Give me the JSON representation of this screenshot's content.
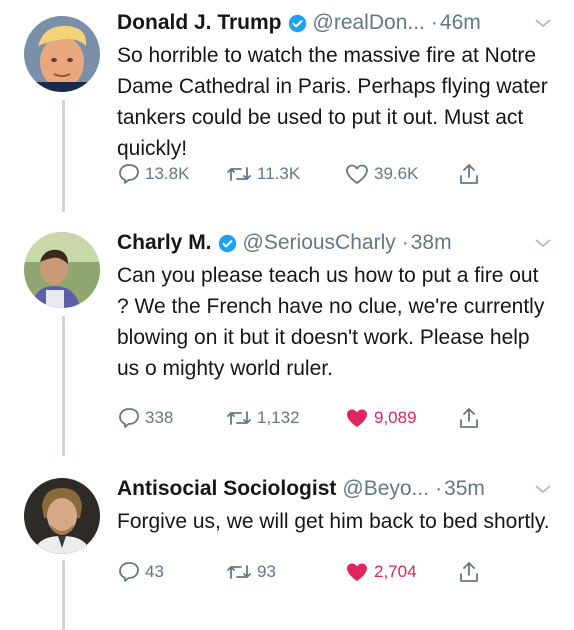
{
  "tweets": [
    {
      "name": "Donald J. Trump",
      "verified": true,
      "handle": "@realDon...",
      "dot": "·",
      "time": "46m",
      "text": "So horrible to watch the massive fire at Notre Dame Cathedral in Paris. Perhaps flying water tankers could be used to put it out. Must act quickly!",
      "replies": "13.8K",
      "retweets": "11.3K",
      "likes": "39.6K",
      "liked": false
    },
    {
      "name": "Charly M.",
      "verified": true,
      "handle": "@SeriousCharly",
      "dot": "·",
      "time": "38m",
      "text": "Can you please teach us how to put a fire out ? We the French have no clue, we're currently blowing on it but it doesn't work. Please help us o mighty world ruler.",
      "replies": "338",
      "retweets": "1,132",
      "likes": "9,089",
      "liked": true
    },
    {
      "name": "Antisocial Sociologist",
      "verified": false,
      "handle": "@Beyo...",
      "dot": "·",
      "time": "35m",
      "text": "Forgive us, we will get him back to bed shortly.",
      "replies": "43",
      "retweets": "93",
      "likes": "2,704",
      "liked": true
    }
  ],
  "icons": {
    "reply": "reply-icon",
    "retweet": "retweet-icon",
    "like": "like-icon",
    "share": "share-icon",
    "verified": "verified-badge-icon",
    "caret": "chevron-down-icon"
  },
  "colors": {
    "text": "#14171a",
    "secondary": "#657786",
    "verified": "#1da1f2",
    "liked": "#e0245e",
    "thread_line": "#ccd6dd"
  }
}
